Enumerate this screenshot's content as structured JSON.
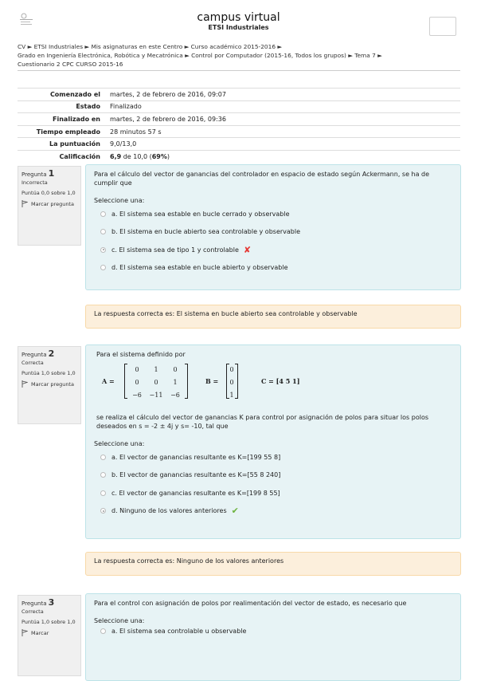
{
  "header": {
    "title": "campus virtual",
    "subtitle": "ETSI Industriales",
    "logo_icon": "university-logo-icon"
  },
  "breadcrumb": {
    "line1": "CV ► ETSI Industriales ► Mis asignaturas en este Centro ► Curso académico 2015-2016 ►",
    "line2": "Grado en Ingeniería Electrónica, Robótica y Mecatrónica ► Control por Computador (2015-16, Todos los grupos) ► Tema 7 ►",
    "line3": "Cuestionario 2 CPC CURSO 2015-16"
  },
  "summary": [
    {
      "label": "Comenzado el",
      "value": "martes, 2 de febrero de 2016, 09:07"
    },
    {
      "label": "Estado",
      "value": "Finalizado"
    },
    {
      "label": "Finalizado en",
      "value": "martes, 2 de febrero de 2016, 09:36"
    },
    {
      "label": "Tiempo empleado",
      "value": "28 minutos 57 s"
    },
    {
      "label": "La puntuación",
      "value": "9,0/13,0"
    },
    {
      "label": "Calificación",
      "value_bold": "6,9",
      "value_mid": " de 10,0 (",
      "value_pct": "69%",
      "value_end": ")"
    }
  ],
  "q1": {
    "label": "Pregunta",
    "num": "1",
    "state": "Incorrecta",
    "score": "Puntúa 0,0 sobre 1,0",
    "flag_text": "Marcar pregunta",
    "text": "Para el cálculo del vector de ganancias del controlador en espacio de estado según Ackermann, se ha de cumplir que",
    "prompt": "Seleccione una:",
    "options": [
      "a. El sistema sea estable en bucle cerrado y observable",
      "b. El sistema en bucle abierto sea controlable y observable",
      "c. El sistema sea de tipo 1 y controlable",
      "d. El sistema sea estable en bucle abierto y observable"
    ],
    "feedback": "La respuesta correcta es: El sistema en bucle abierto sea controlable y observable"
  },
  "q2": {
    "label": "Pregunta",
    "num": "2",
    "state": "Correcta",
    "score": "Puntúa 1,0 sobre 1,0",
    "flag_text": "Marcar pregunta",
    "intro": "Para el sistema definido por",
    "A_label": "A =",
    "A": [
      "0",
      "1",
      "0",
      "0",
      "0",
      "1",
      "−6",
      "−11",
      "−6"
    ],
    "B_label": "B =",
    "B": [
      "0",
      "0",
      "1"
    ],
    "C_label": "C = [4    5    1]",
    "text": "se realiza el cálculo del vector de ganancias K para control por asignación de polos para situar los polos deseados en s = -2 ± 4j y s= -10, tal que",
    "prompt": "Seleccione una:",
    "options": [
      "a. El vector de ganancias resultante es K=[199 55 8]",
      "b. El vector de ganancias resultante es K=[55 8 240]",
      "c. El vector de ganancias resultante es K=[199 8 55]",
      "d. Ninguno de los valores anteriores"
    ],
    "feedback": "La respuesta correcta es: Ninguno de los valores anteriores"
  },
  "q3": {
    "label": "Pregunta",
    "num": "3",
    "state": "Correcta",
    "score": "Puntúa 1,0 sobre 1,0",
    "flag_text": "Marcar",
    "text": "Para el control con asignación de polos por realimentación del vector de estado, es necesario que",
    "prompt": "Seleccione una:",
    "options": [
      "a. El sistema sea controlable u observable"
    ]
  }
}
